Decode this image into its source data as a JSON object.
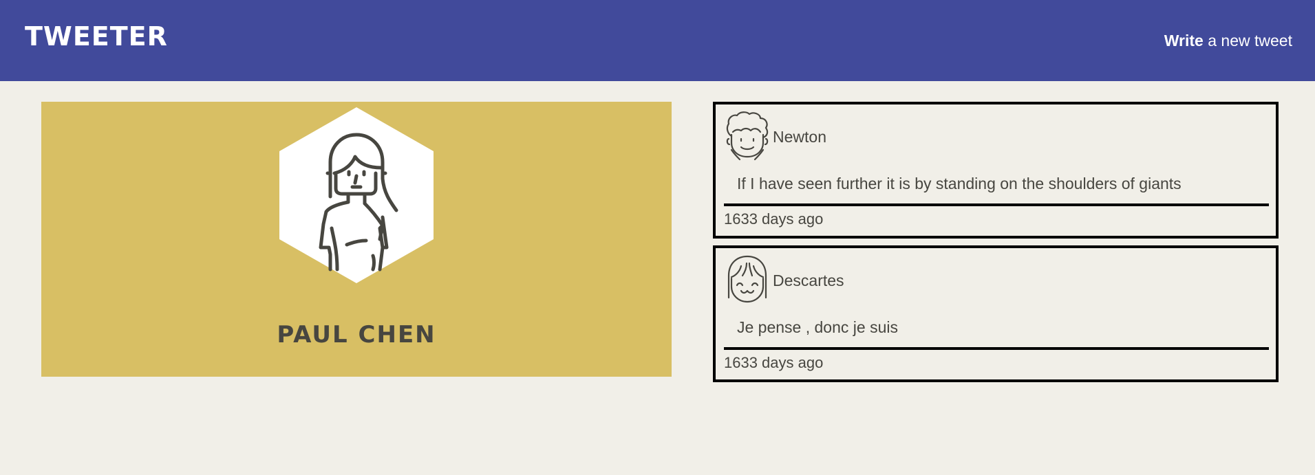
{
  "app": {
    "brand": "TWEETER"
  },
  "header": {
    "write_strong": "Write",
    "write_rest": " a new tweet"
  },
  "profile": {
    "name": "PAUL CHEN",
    "avatar_icon": "woman-avatar-icon",
    "card_color": "#d8bf64"
  },
  "colors": {
    "header_bg": "#414a9b",
    "page_bg": "#f1efe8",
    "text": "#474640"
  },
  "tweets": [
    {
      "author": "Newton",
      "avatar_icon": "curly-hair-face-icon",
      "content": "If I have seen further it is by standing on the shoulders of giants",
      "time": "1633 days ago"
    },
    {
      "author": "Descartes",
      "avatar_icon": "smiling-face-icon",
      "content": "Je pense , donc je suis",
      "time": "1633 days ago"
    }
  ]
}
